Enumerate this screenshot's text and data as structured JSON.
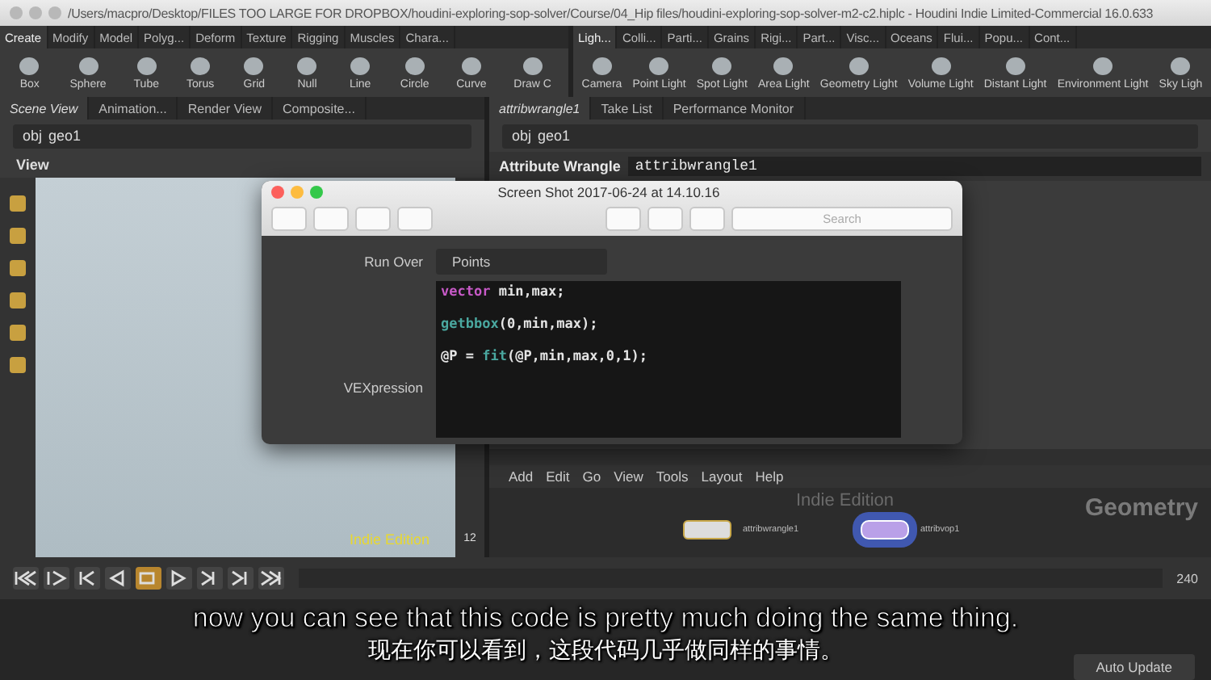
{
  "window": {
    "title": "/Users/macpro/Desktop/FILES TOO LARGE FOR DROPBOX/houdini-exploring-sop-solver/Course/04_Hip files/houdini-exploring-sop-solver-m2-c2.hiplc - Houdini Indie Limited-Commercial 16.0.633"
  },
  "shelf_left": {
    "tabs": [
      {
        "label": "Create",
        "selected": true
      },
      {
        "label": "Modify",
        "selected": false
      },
      {
        "label": "Model",
        "selected": false
      },
      {
        "label": "Polyg...",
        "selected": false
      },
      {
        "label": "Deform",
        "selected": false
      },
      {
        "label": "Texture",
        "selected": false
      },
      {
        "label": "Rigging",
        "selected": false
      },
      {
        "label": "Muscles",
        "selected": false
      },
      {
        "label": "Chara...",
        "selected": false
      }
    ],
    "tools": [
      "Box",
      "Sphere",
      "Tube",
      "Torus",
      "Grid",
      "Null",
      "Line",
      "Circle",
      "Curve",
      "Draw C"
    ]
  },
  "shelf_right": {
    "tabs": [
      {
        "label": "Ligh...",
        "selected": true
      },
      {
        "label": "Colli...",
        "selected": false
      },
      {
        "label": "Parti...",
        "selected": false
      },
      {
        "label": "Grains",
        "selected": false
      },
      {
        "label": "Rigi...",
        "selected": false
      },
      {
        "label": "Part...",
        "selected": false
      },
      {
        "label": "Visc...",
        "selected": false
      },
      {
        "label": "Oceans",
        "selected": false
      },
      {
        "label": "Flui...",
        "selected": false
      },
      {
        "label": "Popu...",
        "selected": false
      },
      {
        "label": "Cont...",
        "selected": false
      }
    ],
    "tools": [
      "Camera",
      "Point Light",
      "Spot Light",
      "Area Light",
      "Geometry Light",
      "Volume Light",
      "Distant Light",
      "Environment Light",
      "Sky Ligh"
    ]
  },
  "scene_view": {
    "tabs": [
      {
        "label": "Scene View",
        "selected": true
      },
      {
        "label": "Animation...",
        "selected": false
      },
      {
        "label": "Render View",
        "selected": false
      },
      {
        "label": "Composite...",
        "selected": false
      }
    ],
    "path": [
      "obj",
      "geo1"
    ],
    "header": "View",
    "watermark": "Indie Edition",
    "toolbar_number": "12"
  },
  "parameters": {
    "tabs": [
      {
        "label": "attribwrangle1",
        "selected": true
      },
      {
        "label": "Take List",
        "selected": false
      },
      {
        "label": "Performance Monitor",
        "selected": false
      }
    ],
    "path": [
      "obj",
      "geo1"
    ],
    "node_type": "Attribute Wrangle",
    "node_name": "attribwrangle1"
  },
  "network": {
    "menu": [
      "Add",
      "Edit",
      "Go",
      "View",
      "Tools",
      "Layout",
      "Help"
    ],
    "watermark": "Indie Edition",
    "context": "Geometry",
    "nodes": [
      {
        "label": "attribwrangle1",
        "selected": false
      },
      {
        "label": "attribvop1",
        "selected": true
      }
    ]
  },
  "playbar": {
    "frame_end": "240"
  },
  "status": {
    "auto_update": "Auto Update"
  },
  "preview_window": {
    "title": "Screen Shot 2017-06-24 at 14.10.16",
    "search": {
      "placeholder": "Search"
    },
    "run_over_label": "Run Over",
    "run_over_value": "Points",
    "vex_label": "VEXpression",
    "code": [
      [
        {
          "text": "vector",
          "kind": "keyword"
        },
        {
          "text": " min,max;",
          "kind": "plain"
        }
      ],
      [
        {
          "text": "getbbox",
          "kind": "function"
        },
        {
          "text": "(0,min,max);",
          "kind": "plain"
        }
      ],
      [
        {
          "text": "@P = ",
          "kind": "plain"
        },
        {
          "text": "fit",
          "kind": "function"
        },
        {
          "text": "(@P,min,max,0,1);",
          "kind": "plain"
        }
      ]
    ]
  },
  "subtitles": [
    "now you can see that this code is pretty much doing the same thing.",
    "现在你可以看到，这段代码几乎做同样的事情。"
  ]
}
